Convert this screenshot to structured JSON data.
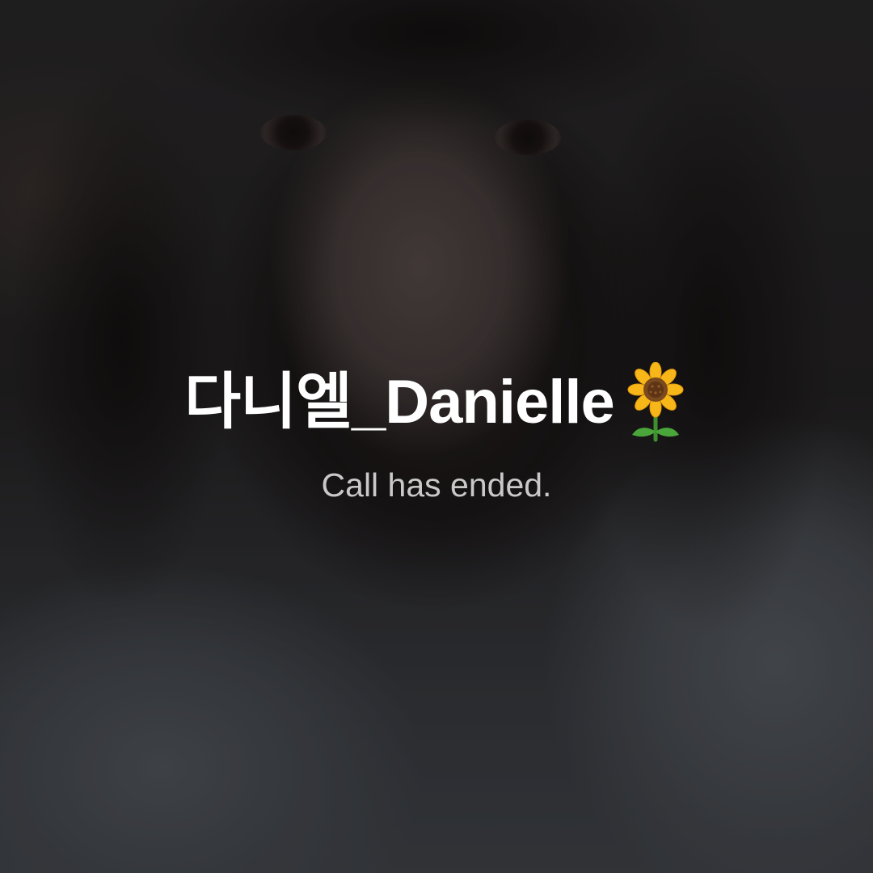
{
  "call": {
    "caller_name": "다니엘_Danielle",
    "caller_emoji_icon": "sunflower-icon",
    "status": "Call has ended."
  },
  "colors": {
    "name_text": "#ffffff",
    "status_text": "#c9c9c9",
    "overlay": "rgba(0,0,0,0.28)"
  }
}
